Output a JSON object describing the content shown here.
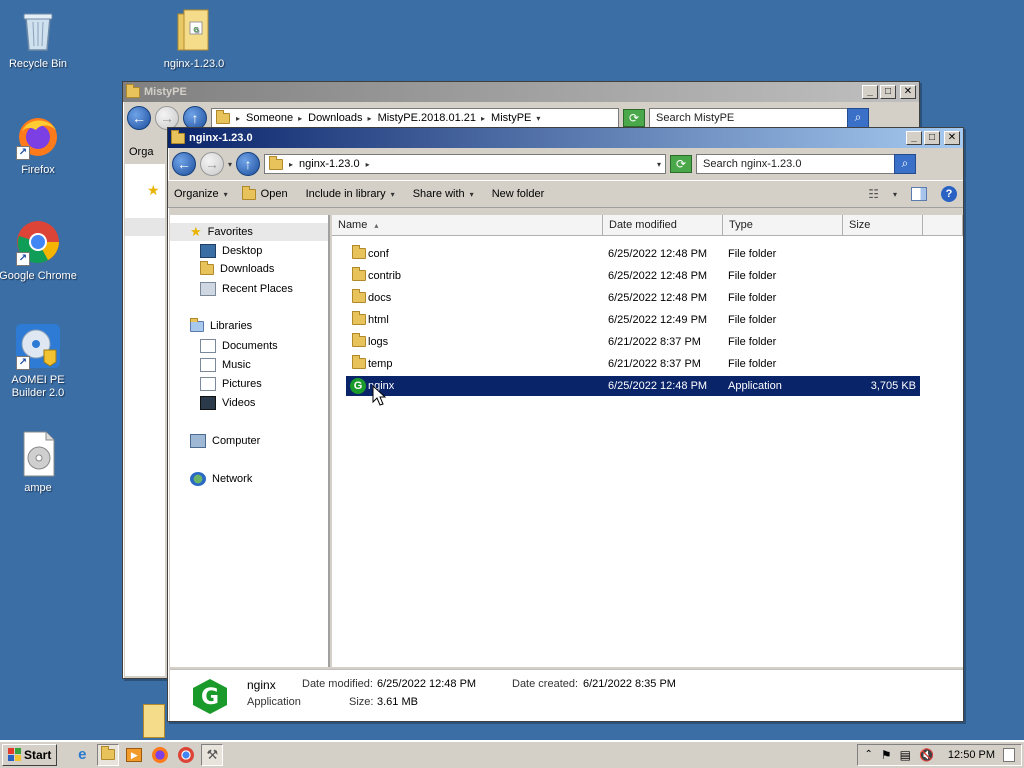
{
  "desktop": {
    "icons": [
      {
        "label": "Recycle Bin"
      },
      {
        "label": "nginx-1.23.0"
      },
      {
        "label": "Firefox"
      },
      {
        "label": "Google Chrome"
      },
      {
        "label": "AOMEI PE Builder 2.0"
      },
      {
        "label": "ampe"
      }
    ]
  },
  "back_window": {
    "title": "MistyPE",
    "breadcrumb": [
      "Someone",
      "Downloads",
      "MistyPE.2018.01.21",
      "MistyPE"
    ],
    "search_placeholder": "Search MistyPE",
    "toolbar_first": "Orga"
  },
  "window": {
    "title": "nginx-1.23.0",
    "address": "nginx-1.23.0",
    "search_placeholder": "Search nginx-1.23.0",
    "toolbar": {
      "organize": "Organize",
      "open": "Open",
      "include_in_library": "Include in library",
      "share_with": "Share with",
      "new_folder": "New folder"
    },
    "nav": {
      "favorites": "Favorites",
      "desktop": "Desktop",
      "downloads": "Downloads",
      "recent_places": "Recent Places",
      "libraries": "Libraries",
      "documents": "Documents",
      "music": "Music",
      "pictures": "Pictures",
      "videos": "Videos",
      "computer": "Computer",
      "network": "Network"
    },
    "columns": {
      "name": "Name",
      "date_modified": "Date modified",
      "type": "Type",
      "size": "Size"
    },
    "files": [
      {
        "name": "conf",
        "date": "6/25/2022 12:48 PM",
        "type": "File folder",
        "size": ""
      },
      {
        "name": "contrib",
        "date": "6/25/2022 12:48 PM",
        "type": "File folder",
        "size": ""
      },
      {
        "name": "docs",
        "date": "6/25/2022 12:48 PM",
        "type": "File folder",
        "size": ""
      },
      {
        "name": "html",
        "date": "6/25/2022 12:49 PM",
        "type": "File folder",
        "size": ""
      },
      {
        "name": "logs",
        "date": "6/21/2022 8:37 PM",
        "type": "File folder",
        "size": ""
      },
      {
        "name": "temp",
        "date": "6/21/2022 8:37 PM",
        "type": "File folder",
        "size": ""
      },
      {
        "name": "nginx",
        "date": "6/25/2022 12:48 PM",
        "type": "Application",
        "size": "3,705 KB"
      }
    ],
    "details": {
      "name": "nginx",
      "type": "Application",
      "date_modified_label": "Date modified:",
      "date_modified": "6/25/2022 12:48 PM",
      "date_created_label": "Date created:",
      "date_created": "6/21/2022 8:35 PM",
      "size_label": "Size:",
      "size": "3.61 MB"
    }
  },
  "taskbar": {
    "start": "Start",
    "clock": "12:50 PM"
  },
  "colors": {
    "desktop": "#3a6ea5",
    "selection": "#0a246a",
    "nginx_green": "#1a9a2a"
  }
}
